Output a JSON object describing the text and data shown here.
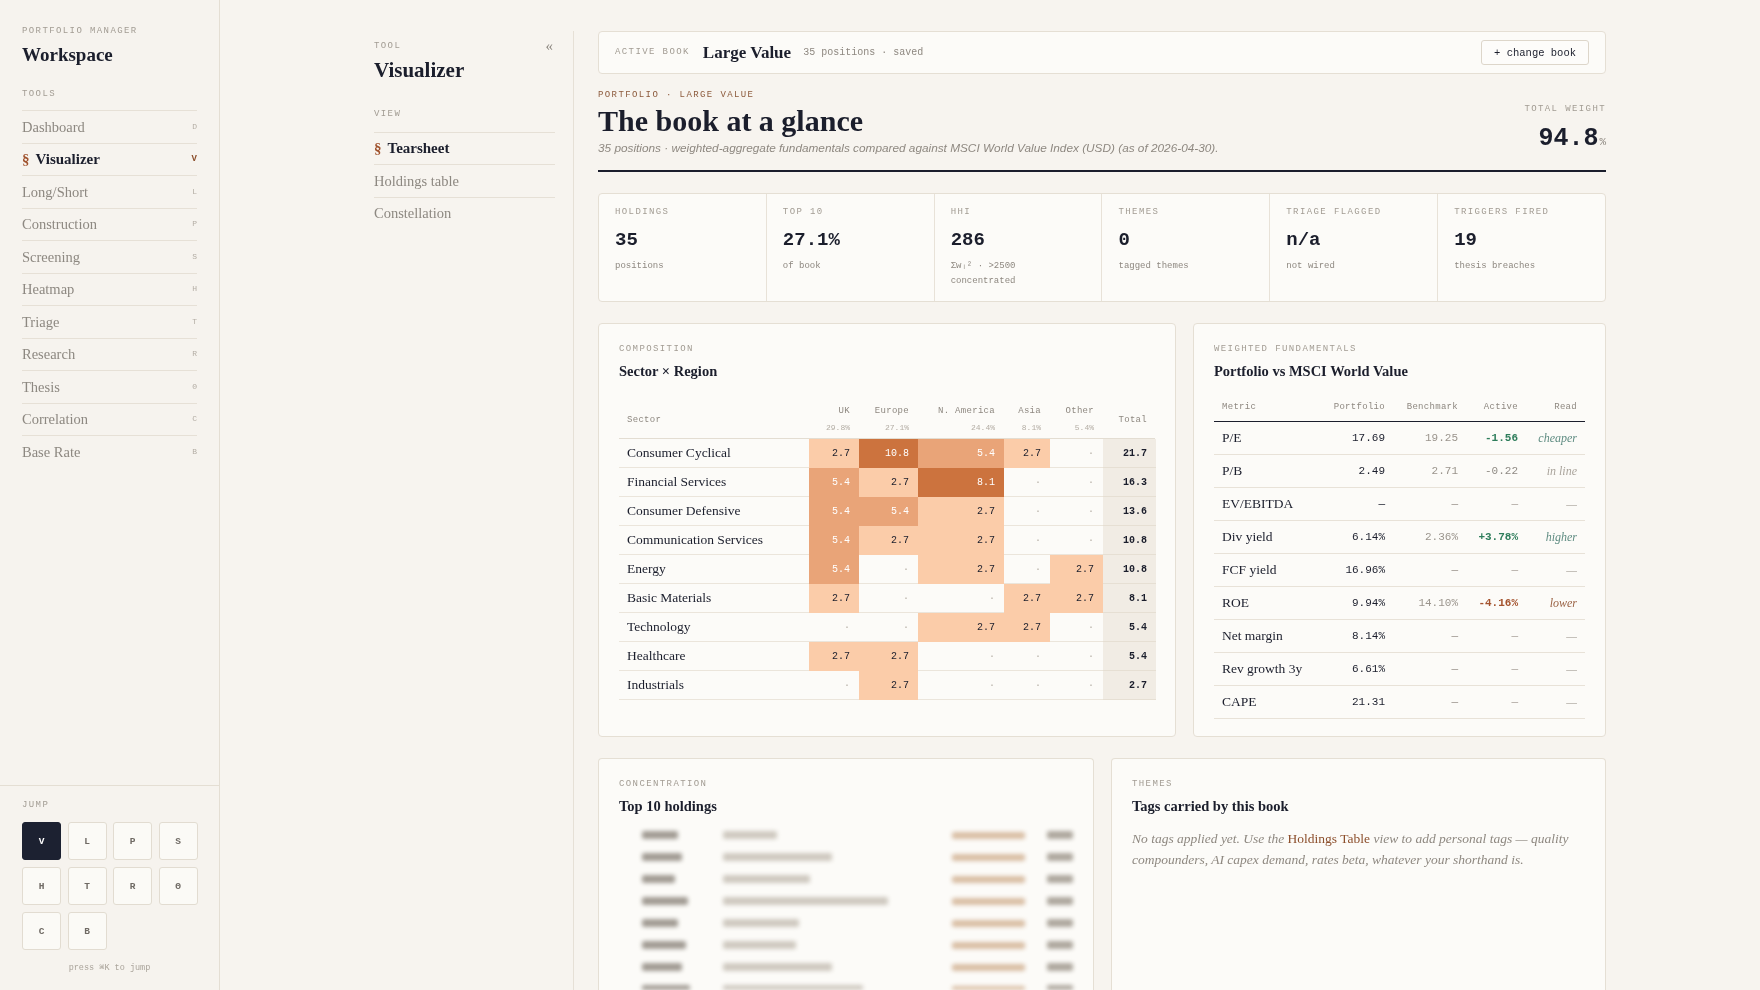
{
  "sidebar": {
    "eyebrow": "PORTFOLIO MANAGER",
    "title": "Workspace",
    "section_label": "TOOLS",
    "selected_marker": "§",
    "items": [
      {
        "label": "Dashboard",
        "key": "D",
        "selected": false
      },
      {
        "label": "Visualizer",
        "key": "V",
        "selected": true
      },
      {
        "label": "Long/Short",
        "key": "L",
        "selected": false
      },
      {
        "label": "Construction",
        "key": "P",
        "selected": false
      },
      {
        "label": "Screening",
        "key": "S",
        "selected": false
      },
      {
        "label": "Heatmap",
        "key": "H",
        "selected": false
      },
      {
        "label": "Triage",
        "key": "T",
        "selected": false
      },
      {
        "label": "Research",
        "key": "R",
        "selected": false
      },
      {
        "label": "Thesis",
        "key": "Θ",
        "selected": false
      },
      {
        "label": "Correlation",
        "key": "C",
        "selected": false
      },
      {
        "label": "Base Rate",
        "key": "B",
        "selected": false
      }
    ],
    "jump": {
      "label": "JUMP",
      "keys": [
        {
          "label": "V",
          "selected": true
        },
        {
          "label": "L",
          "selected": false
        },
        {
          "label": "P",
          "selected": false
        },
        {
          "label": "S",
          "selected": false
        },
        {
          "label": "H",
          "selected": false
        },
        {
          "label": "T",
          "selected": false
        },
        {
          "label": "R",
          "selected": false
        },
        {
          "label": "Θ",
          "selected": false
        },
        {
          "label": "C",
          "selected": false
        },
        {
          "label": "B",
          "selected": false
        }
      ],
      "hint": "press ⌘K to jump"
    }
  },
  "tool_nav": {
    "eyebrow": "TOOL",
    "title": "Visualizer",
    "collapse": "«",
    "section_label": "VIEW",
    "selected_marker": "§",
    "items": [
      {
        "label": "Tearsheet",
        "selected": true
      },
      {
        "label": "Holdings table",
        "selected": false
      },
      {
        "label": "Constellation",
        "selected": false
      }
    ]
  },
  "active_book": {
    "label": "ACTIVE BOOK",
    "name": "Large Value",
    "meta": "35 positions · saved",
    "button": "+ change book"
  },
  "header": {
    "eyebrow": "PORTFOLIO · LARGE VALUE",
    "title": "The book at a glance",
    "subtitle": "35 positions · weighted-aggregate fundamentals compared against MSCI World Value Index (USD) (as of 2026-04-30).",
    "total_label": "TOTAL WEIGHT",
    "total_value": "94.8",
    "total_unit": "%"
  },
  "stats": [
    {
      "label": "HOLDINGS",
      "value": "35",
      "sub": "positions"
    },
    {
      "label": "TOP 10",
      "value": "27.1%",
      "sub": "of book"
    },
    {
      "label": "HHI",
      "value": "286",
      "sub": "Σwᵢ² · >2500 concentrated"
    },
    {
      "label": "THEMES",
      "value": "0",
      "sub": "tagged themes"
    },
    {
      "label": "TRIAGE FLAGGED",
      "value": "n/a",
      "sub": "not wired"
    },
    {
      "label": "TRIGGERS FIRED",
      "value": "19",
      "sub": "thesis breaches"
    }
  ],
  "composition": {
    "eyebrow": "COMPOSITION",
    "title": "Sector × Region",
    "columns": [
      {
        "label": "Sector"
      },
      {
        "label": "UK",
        "share": "29.8%"
      },
      {
        "label": "Europe",
        "share": "27.1%"
      },
      {
        "label": "N. America",
        "share": "24.4%"
      },
      {
        "label": "Asia",
        "share": "8.1%"
      },
      {
        "label": "Other",
        "share": "5.4%"
      },
      {
        "label": "Total"
      }
    ],
    "rows": [
      {
        "cells": [
          {
            "value": "Consumer Cyclical"
          },
          {
            "value": "2.7",
            "color": "#fbcca9"
          },
          {
            "value": "10.8",
            "color": "#cc733e"
          },
          {
            "value": "5.4",
            "color": "#e9a478"
          },
          {
            "value": "2.7",
            "color": "#fbcca9"
          },
          {
            "value": "·"
          },
          {
            "value": "21.7"
          }
        ]
      },
      {
        "cells": [
          {
            "value": "Financial Services"
          },
          {
            "value": "5.4",
            "color": "#e9a478"
          },
          {
            "value": "2.7",
            "color": "#fbcca9"
          },
          {
            "value": "8.1",
            "color": "#cc733e"
          },
          {
            "value": "·"
          },
          {
            "value": "·"
          },
          {
            "value": "16.3"
          }
        ]
      },
      {
        "cells": [
          {
            "value": "Consumer Defensive"
          },
          {
            "value": "5.4",
            "color": "#e9a478"
          },
          {
            "value": "5.4",
            "color": "#e9a478"
          },
          {
            "value": "2.7",
            "color": "#fbcca9"
          },
          {
            "value": "·"
          },
          {
            "value": "·"
          },
          {
            "value": "13.6"
          }
        ]
      },
      {
        "cells": [
          {
            "value": "Communication Services"
          },
          {
            "value": "5.4",
            "color": "#e9a478"
          },
          {
            "value": "2.7",
            "color": "#fbcca9"
          },
          {
            "value": "2.7",
            "color": "#fbcca9"
          },
          {
            "value": "·"
          },
          {
            "value": "·"
          },
          {
            "value": "10.8"
          }
        ]
      },
      {
        "cells": [
          {
            "value": "Energy"
          },
          {
            "value": "5.4",
            "color": "#e9a478"
          },
          {
            "value": "·"
          },
          {
            "value": "2.7",
            "color": "#fbcca9"
          },
          {
            "value": "·"
          },
          {
            "value": "2.7",
            "color": "#fbcca9"
          },
          {
            "value": "10.8"
          }
        ]
      },
      {
        "cells": [
          {
            "value": "Basic Materials"
          },
          {
            "value": "2.7",
            "color": "#fbcca9"
          },
          {
            "value": "·"
          },
          {
            "value": "·"
          },
          {
            "value": "2.7",
            "color": "#fbcca9"
          },
          {
            "value": "2.7",
            "color": "#fbcca9"
          },
          {
            "value": "8.1"
          }
        ]
      },
      {
        "cells": [
          {
            "value": "Technology"
          },
          {
            "value": "·"
          },
          {
            "value": "·"
          },
          {
            "value": "2.7",
            "color": "#fbcca9"
          },
          {
            "value": "2.7",
            "color": "#fbcca9"
          },
          {
            "value": "·"
          },
          {
            "value": "5.4"
          }
        ]
      },
      {
        "cells": [
          {
            "value": "Healthcare"
          },
          {
            "value": "2.7",
            "color": "#fbcca9"
          },
          {
            "value": "2.7",
            "color": "#fbcca9"
          },
          {
            "value": "·"
          },
          {
            "value": "·"
          },
          {
            "value": "·"
          },
          {
            "value": "5.4"
          }
        ]
      },
      {
        "cells": [
          {
            "value": "Industrials"
          },
          {
            "value": "·"
          },
          {
            "value": "2.7",
            "color": "#fbcca9"
          },
          {
            "value": "·"
          },
          {
            "value": "·"
          },
          {
            "value": "·"
          },
          {
            "value": "2.7"
          }
        ]
      }
    ]
  },
  "fundamentals": {
    "eyebrow": "WEIGHTED FUNDAMENTALS",
    "title": "Portfolio vs MSCI World Value",
    "columns": [
      "Metric",
      "Portfolio",
      "Benchmark",
      "Active",
      "Read"
    ],
    "rows": [
      {
        "metric": "P/E",
        "portfolio": "17.69",
        "benchmark": "19.25",
        "active": "-1.56",
        "read": "cheaper",
        "kind": "good"
      },
      {
        "metric": "P/B",
        "portfolio": "2.49",
        "benchmark": "2.71",
        "active": "-0.22",
        "read": "in line",
        "kind": "neutral"
      },
      {
        "metric": "EV/EBITDA",
        "portfolio": "—",
        "benchmark": "—",
        "active": "—",
        "read": "—",
        "kind": "none"
      },
      {
        "metric": "Div yield",
        "portfolio": "6.14%",
        "benchmark": "2.36%",
        "active": "+3.78%",
        "read": "higher",
        "kind": "good"
      },
      {
        "metric": "FCF yield",
        "portfolio": "16.96%",
        "benchmark": "—",
        "active": "—",
        "read": "—",
        "kind": "none"
      },
      {
        "metric": "ROE",
        "portfolio": "9.94%",
        "benchmark": "14.10%",
        "active": "-4.16%",
        "read": "lower",
        "kind": "bad"
      },
      {
        "metric": "Net margin",
        "portfolio": "8.14%",
        "benchmark": "—",
        "active": "—",
        "read": "—",
        "kind": "none"
      },
      {
        "metric": "Rev growth 3y",
        "portfolio": "6.61%",
        "benchmark": "—",
        "active": "—",
        "read": "—",
        "kind": "none"
      },
      {
        "metric": "CAPE",
        "portfolio": "21.31",
        "benchmark": "—",
        "active": "—",
        "read": "—",
        "kind": "none"
      }
    ]
  },
  "concentration": {
    "eyebrow": "CONCENTRATION",
    "title": "Top 10 holdings"
  },
  "themes": {
    "eyebrow": "THEMES",
    "title": "Tags carried by this book",
    "text_before": "No tags applied yet. Use the ",
    "link": "Holdings Table",
    "text_after": " view to add personal tags — quality compounders, AI capex demand, rates beta, whatever your shorthand is."
  }
}
